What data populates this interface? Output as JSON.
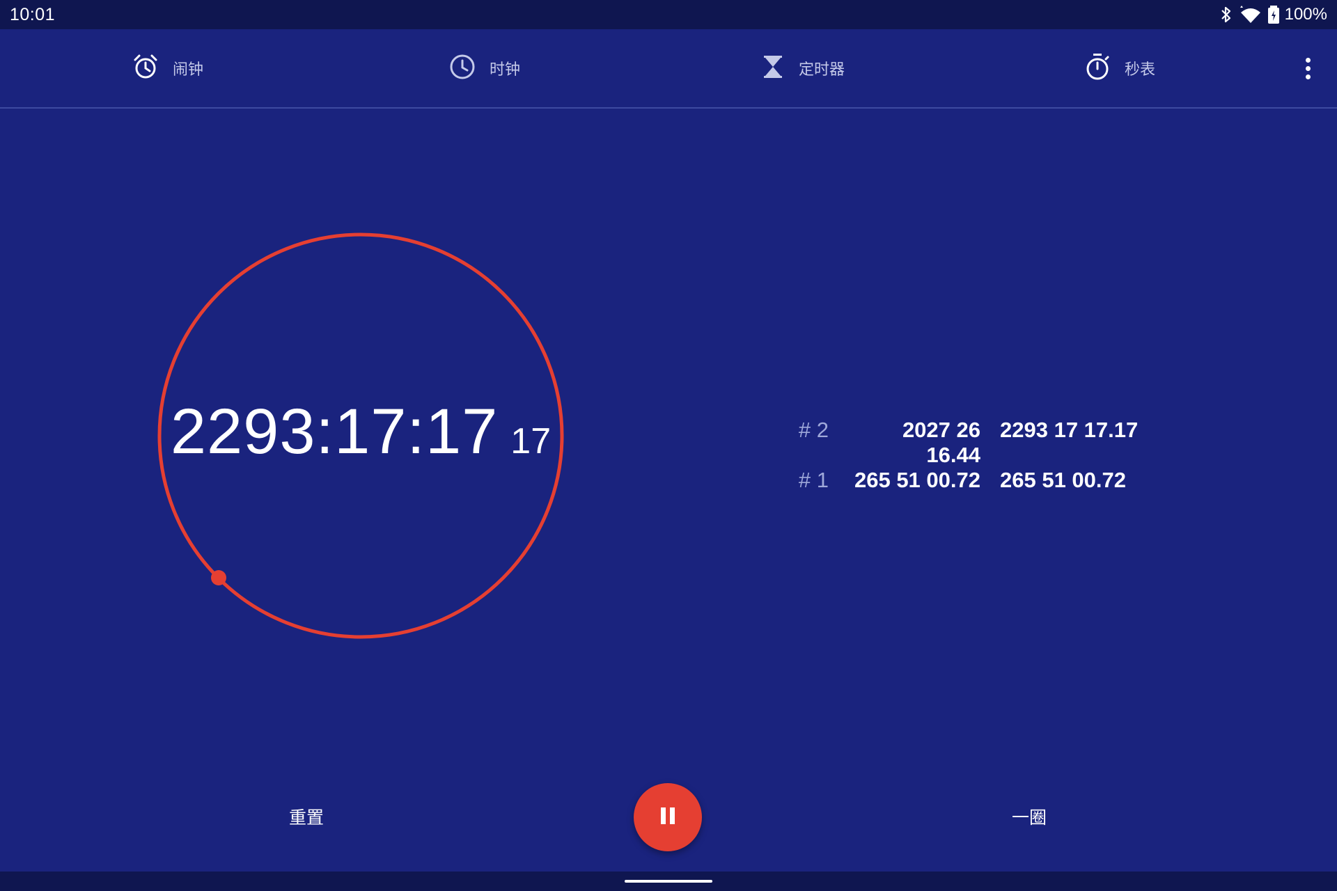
{
  "status_bar": {
    "time": "10:01",
    "battery": "100%"
  },
  "tabs": [
    {
      "label": "闹钟",
      "icon": "alarm-icon"
    },
    {
      "label": "时钟",
      "icon": "clock-icon"
    },
    {
      "label": "定时器",
      "icon": "hourglass-icon"
    },
    {
      "label": "秒表",
      "icon": "stopwatch-icon"
    }
  ],
  "stopwatch": {
    "elapsed": "2293:17:17",
    "hundredths": "17",
    "accent_color": "#e53f32"
  },
  "laps": [
    {
      "number": "# 2",
      "lap_time": "2027 26 16.44",
      "total_time": "2293 17 17.17"
    },
    {
      "number": "# 1",
      "lap_time": "265 51 00.72",
      "total_time": "265 51 00.72"
    }
  ],
  "controls": {
    "reset_label": "重置",
    "lap_label": "一圈",
    "fab_icon": "pause-icon"
  },
  "colors": {
    "background": "#1a237e",
    "bars": "#0f1650",
    "accent": "#e53f32"
  }
}
